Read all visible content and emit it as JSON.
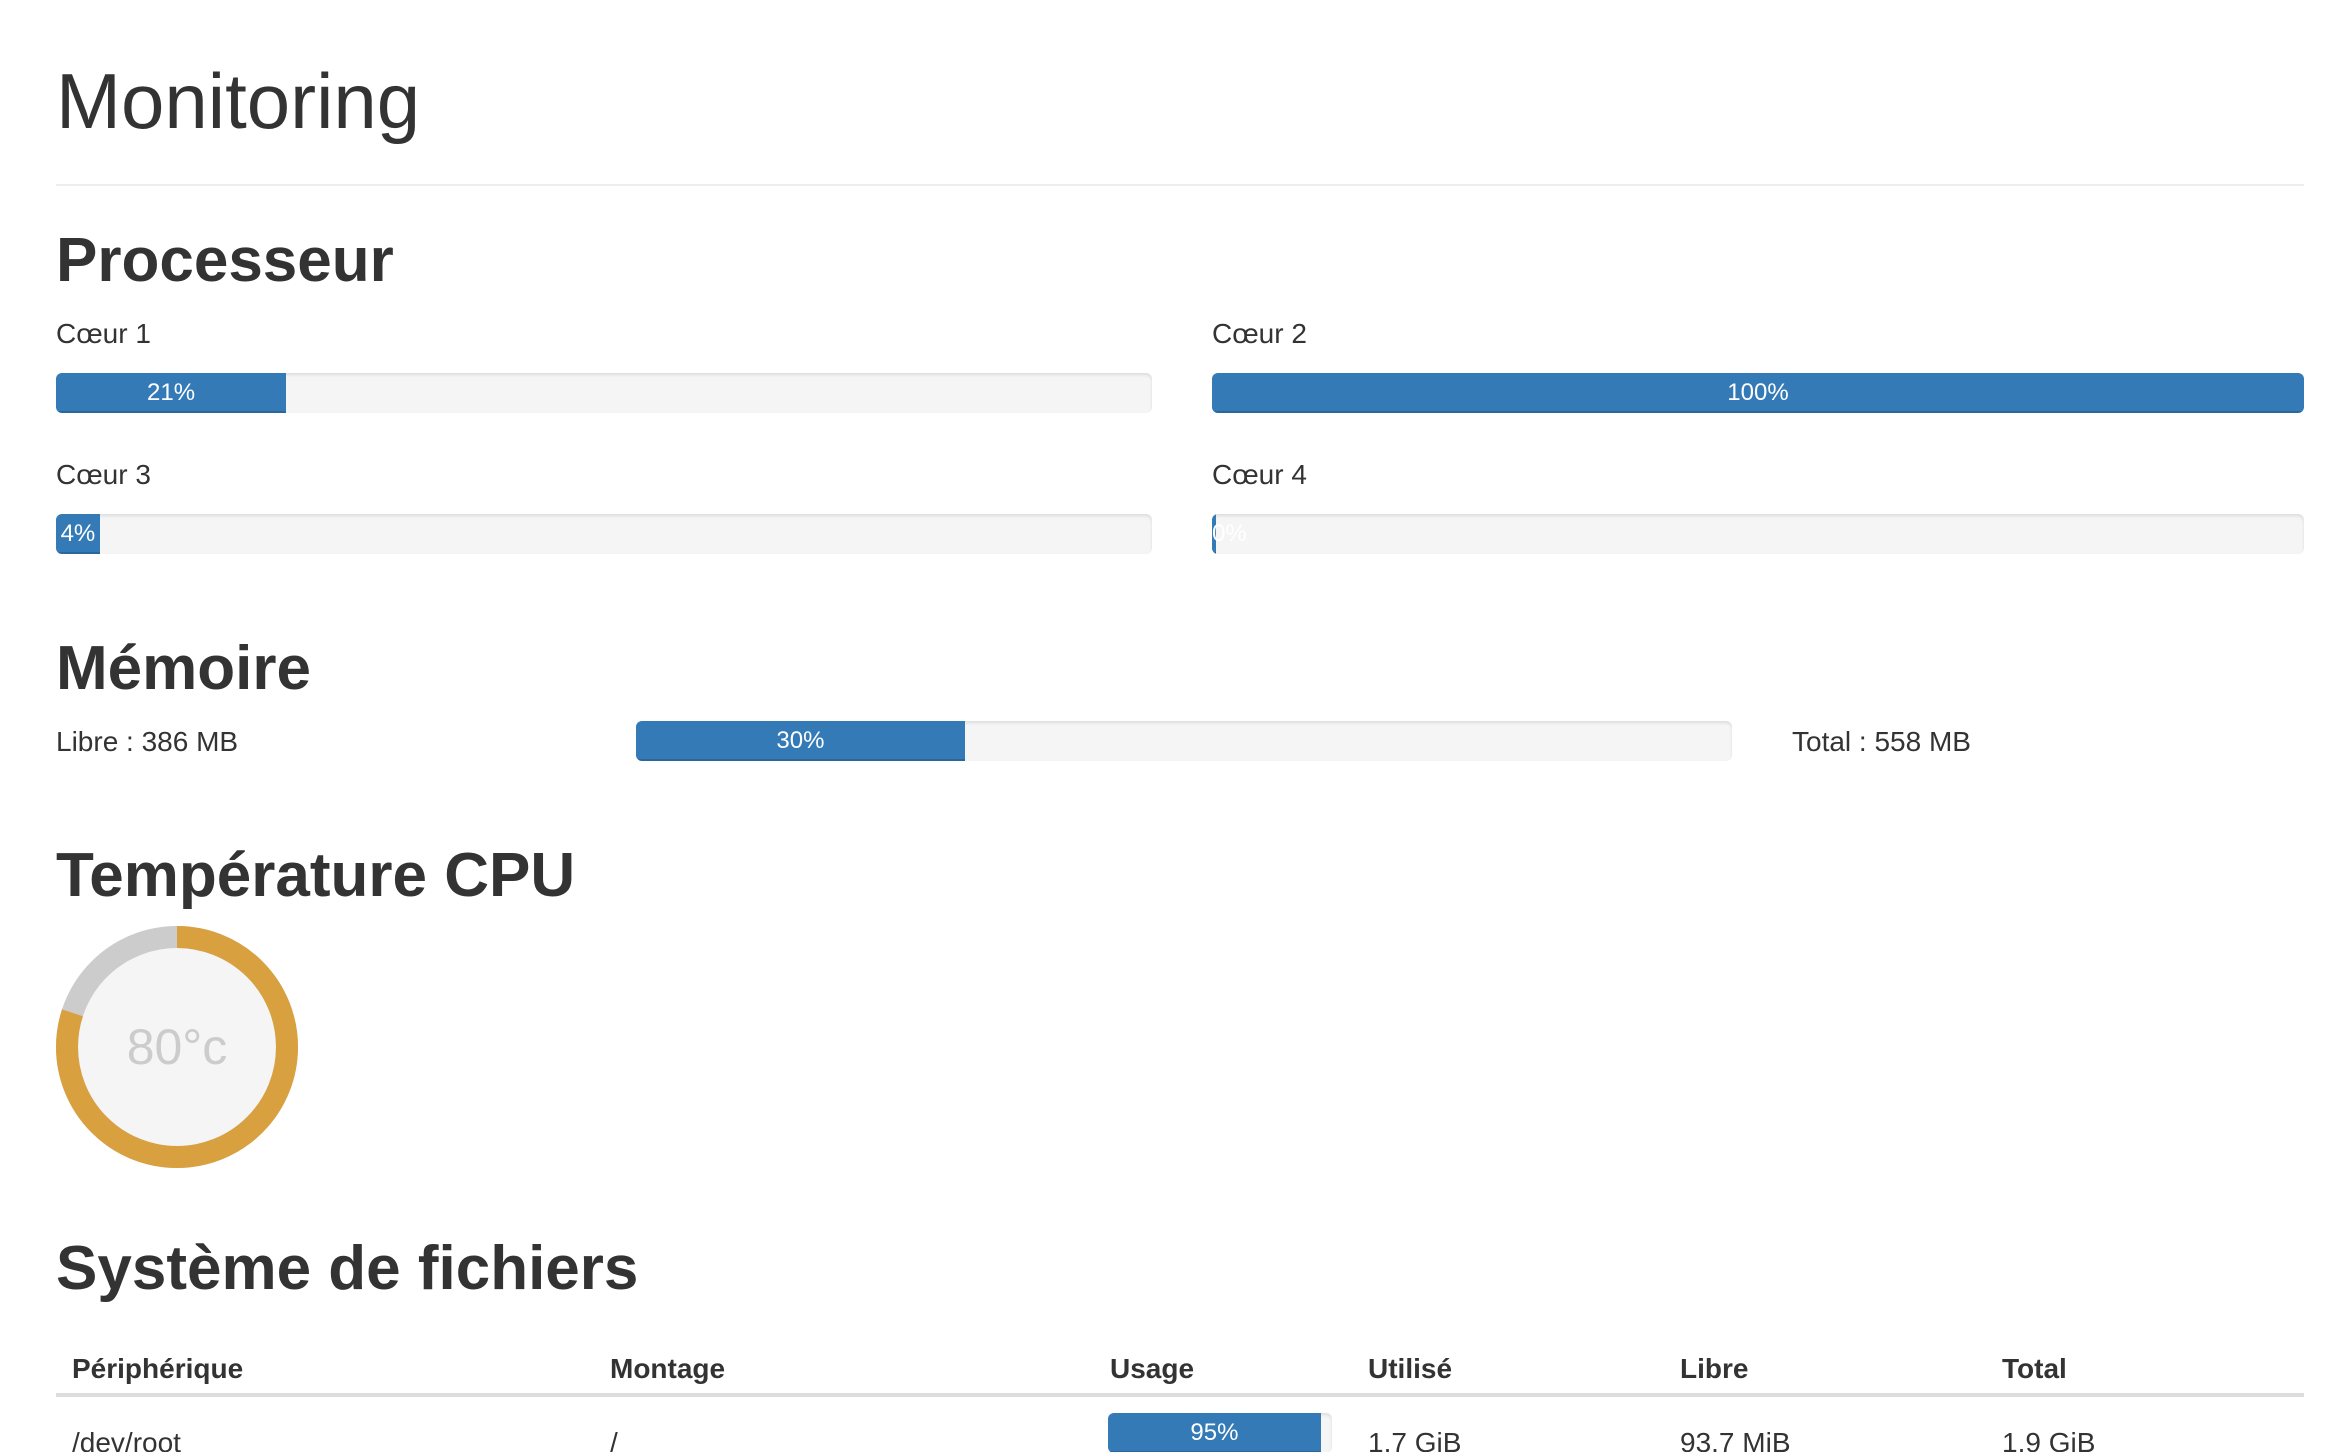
{
  "page": {
    "title": "Monitoring"
  },
  "processor": {
    "title": "Processeur",
    "cores": [
      {
        "label": "Cœur 1",
        "value_text": "21%",
        "fraction": 0.21
      },
      {
        "label": "Cœur 2",
        "value_text": "100%",
        "fraction": 1.0
      },
      {
        "label": "Cœur 3",
        "value_text": "4%",
        "fraction": 0.04
      },
      {
        "label": "Cœur 4",
        "value_text": "0%",
        "fraction": 0.0
      }
    ]
  },
  "memory": {
    "title": "Mémoire",
    "free_label": "Libre : 386 MB",
    "usage_text": "30%",
    "usage_fraction": 0.3,
    "total_label": "Total : 558 MB"
  },
  "temperature": {
    "title": "Température CPU",
    "value_text": "80°c",
    "fraction": 0.8,
    "gauge_color": "#d9a03f",
    "track_color": "#cccccc"
  },
  "filesystem": {
    "title": "Système de fichiers",
    "columns": [
      "Périphérique",
      "Montage",
      "Usage",
      "Utilisé",
      "Libre",
      "Total"
    ],
    "rows": [
      {
        "device": "/dev/root",
        "mount": "/",
        "usage_text": "95%",
        "usage_fraction": 0.95,
        "used": "1.7 GiB",
        "free": "93.7 MiB",
        "total": "1.9 GiB"
      }
    ]
  },
  "colors": {
    "accent": "#337ab7",
    "track": "#f5f5f5",
    "text": "#333333"
  }
}
